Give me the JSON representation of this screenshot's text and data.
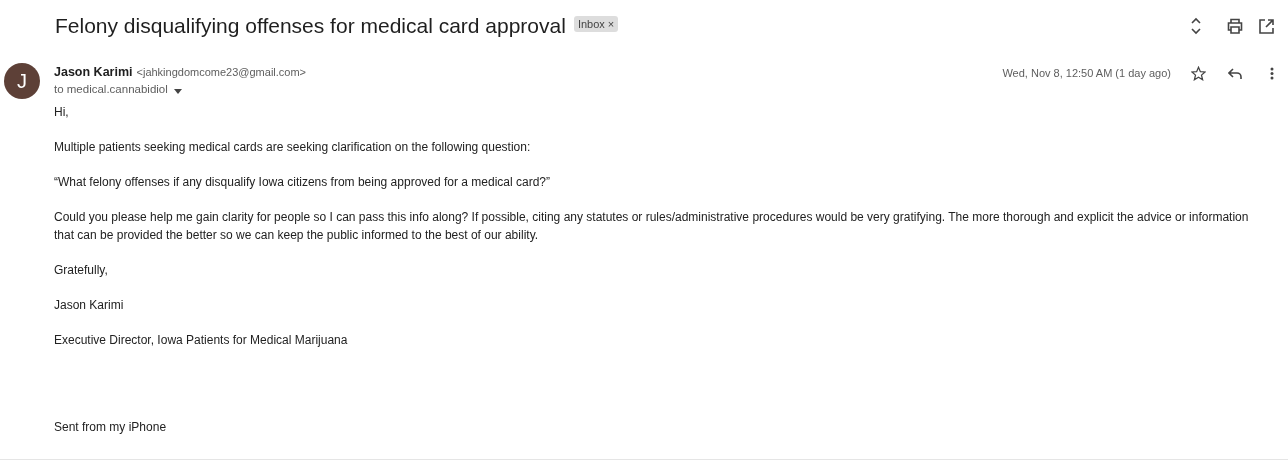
{
  "subject": "Felony disqualifying offenses for medical card approval",
  "labels": [
    {
      "text": "Inbox",
      "close": "×"
    }
  ],
  "sender": {
    "initial": "J",
    "name": "Jason Karimi",
    "email": "<jahkingdomcome23@gmail.com>",
    "to": "to medical.cannabidiol"
  },
  "date": "Wed, Nov 8, 12:50 AM (1 day ago)",
  "starred": false,
  "body": [
    {
      "kind": "text",
      "text": "Hi,"
    },
    {
      "kind": "text",
      "text": "Multiple patients seeking medical cards are seeking clarification on the following question:"
    },
    {
      "kind": "text",
      "text": "“What felony offenses if any disqualify Iowa citizens from being approved for a medical card?”"
    },
    {
      "kind": "text",
      "text": "Could you please help me gain clarity for people so I can pass this info along? If possible, citing any statutes or rules/administrative procedures would be very gratifying. The more thorough and explicit the advice or information that can be provided the better so we can keep the public informed to the best of our ability."
    },
    {
      "kind": "text",
      "text": "Gratefully,"
    },
    {
      "kind": "text",
      "text": "Jason Karimi"
    },
    {
      "kind": "text",
      "text": "Executive Director, Iowa Patients for Medical Marijuana"
    },
    {
      "kind": "footer",
      "text": "Sent from my iPhone"
    }
  ]
}
